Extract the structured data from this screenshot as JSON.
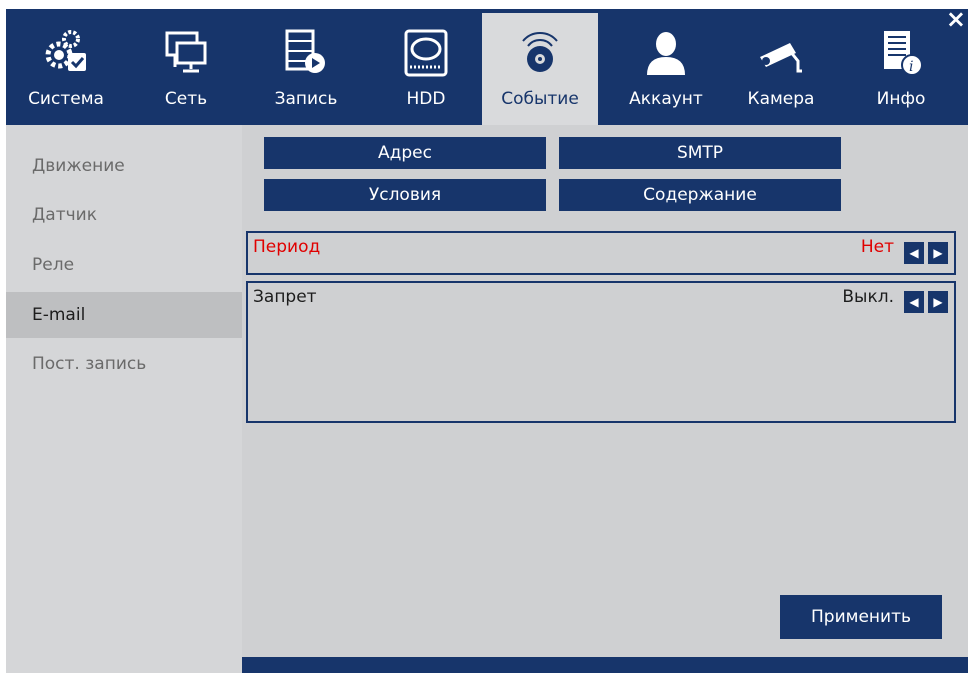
{
  "tabs": [
    {
      "label": "Система",
      "icon": "system-gears-icon"
    },
    {
      "label": "Сеть",
      "icon": "network-monitors-icon"
    },
    {
      "label": "Запись",
      "icon": "record-film-icon"
    },
    {
      "label": "HDD",
      "icon": "hdd-icon"
    },
    {
      "label": "Событие",
      "icon": "alarm-bell-icon"
    },
    {
      "label": "Аккаунт",
      "icon": "user-account-icon"
    },
    {
      "label": "Камера",
      "icon": "camera-icon"
    },
    {
      "label": "Инфо",
      "icon": "info-document-icon"
    }
  ],
  "close_symbol": "×",
  "sidebar": {
    "items": [
      {
        "label": "Движение"
      },
      {
        "label": "Датчик"
      },
      {
        "label": "Реле"
      },
      {
        "label": "E-mail"
      },
      {
        "label": "Пост. запись"
      }
    ]
  },
  "subtabs": [
    "Адрес",
    "SMTP",
    "Условия",
    "Содержание"
  ],
  "rows": {
    "period": {
      "label": "Период",
      "value": "Нет"
    },
    "ban": {
      "label": "Запрет",
      "value": "Выкл."
    }
  },
  "arrows": {
    "left": "◀",
    "right": "▶"
  },
  "apply_label": "Применить",
  "colors": {
    "accent": "#17356b",
    "highlight": "#e00000",
    "panel": "#cfd0d2"
  }
}
